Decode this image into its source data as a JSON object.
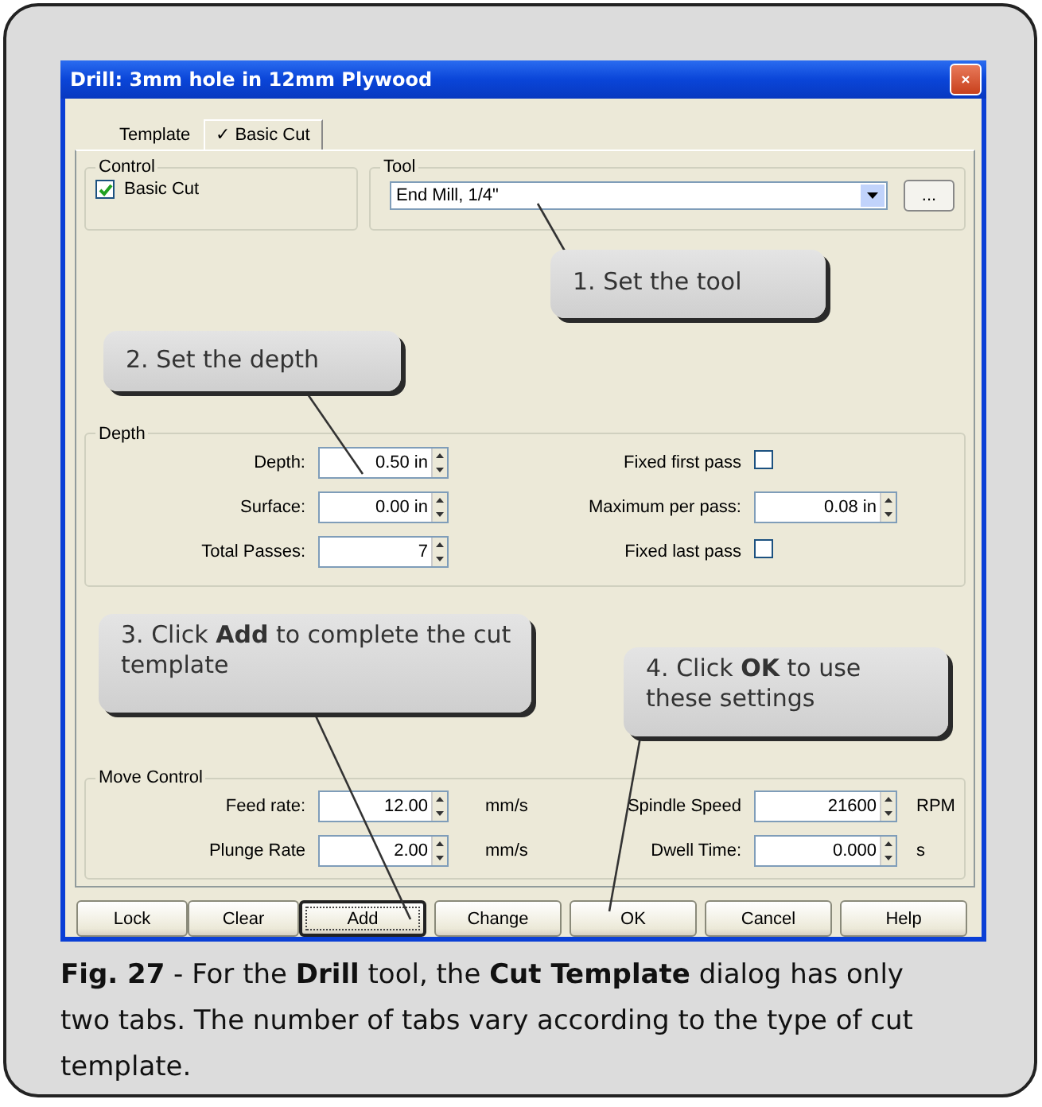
{
  "dialog": {
    "title": "Drill: 3mm hole in 12mm Plywood",
    "tabs": [
      {
        "label": "Template",
        "selected": false
      },
      {
        "label": "✓ Basic Cut",
        "selected": true
      }
    ],
    "control": {
      "title": "Control",
      "checkbox": {
        "label": "Basic Cut",
        "checked": true
      }
    },
    "tool": {
      "title": "Tool",
      "value": "End Mill, 1/4\"",
      "browse_button": "..."
    },
    "depth": {
      "title": "Depth",
      "rows": [
        {
          "left": {
            "label": "Depth:",
            "value": "0.50 in"
          },
          "right": {
            "kind": "checkbox",
            "label": "Fixed first pass",
            "checked": false
          }
        },
        {
          "left": {
            "label": "Surface:",
            "value": "0.00 in"
          },
          "right": {
            "kind": "spin",
            "label": "Maximum per pass:",
            "value": "0.08 in"
          }
        },
        {
          "left": {
            "label": "Total Passes:",
            "value": "7"
          },
          "right": {
            "kind": "checkbox",
            "label": "Fixed last pass",
            "checked": false
          }
        }
      ]
    },
    "move_control": {
      "title": "Move Control",
      "rows": [
        {
          "left": {
            "label": "Feed rate:",
            "value": "12.00",
            "unit": "mm/s"
          },
          "right": {
            "kind": "spin",
            "label": "Spindle Speed",
            "value": "21600",
            "unit": "RPM"
          }
        },
        {
          "left": {
            "label": "Plunge Rate",
            "value": "2.00",
            "unit": "mm/s"
          },
          "right": {
            "kind": "spin",
            "label": "Dwell Time:",
            "value": "0.000",
            "unit": "s"
          }
        }
      ]
    },
    "buttons": [
      {
        "label": "Lock",
        "default": false
      },
      {
        "label": "Clear",
        "default": false
      },
      {
        "label": "Add",
        "default": true
      },
      {
        "label": "Change",
        "default": false
      },
      {
        "label": "OK",
        "default": false
      },
      {
        "label": "Cancel",
        "default": false
      },
      {
        "label": "Help",
        "default": false
      }
    ]
  },
  "callouts": [
    {
      "text": "1. Set the tool"
    },
    {
      "text": "2. Set the depth"
    },
    {
      "text": "3. Click **Add** to complete the cut template"
    },
    {
      "text": "4. Click **OK** to use these settings"
    }
  ],
  "caption": "**Fig. 27** - For the **Drill** tool, the **Cut Template** dialog has only two tabs. The number of tabs vary according to the type of cut template."
}
